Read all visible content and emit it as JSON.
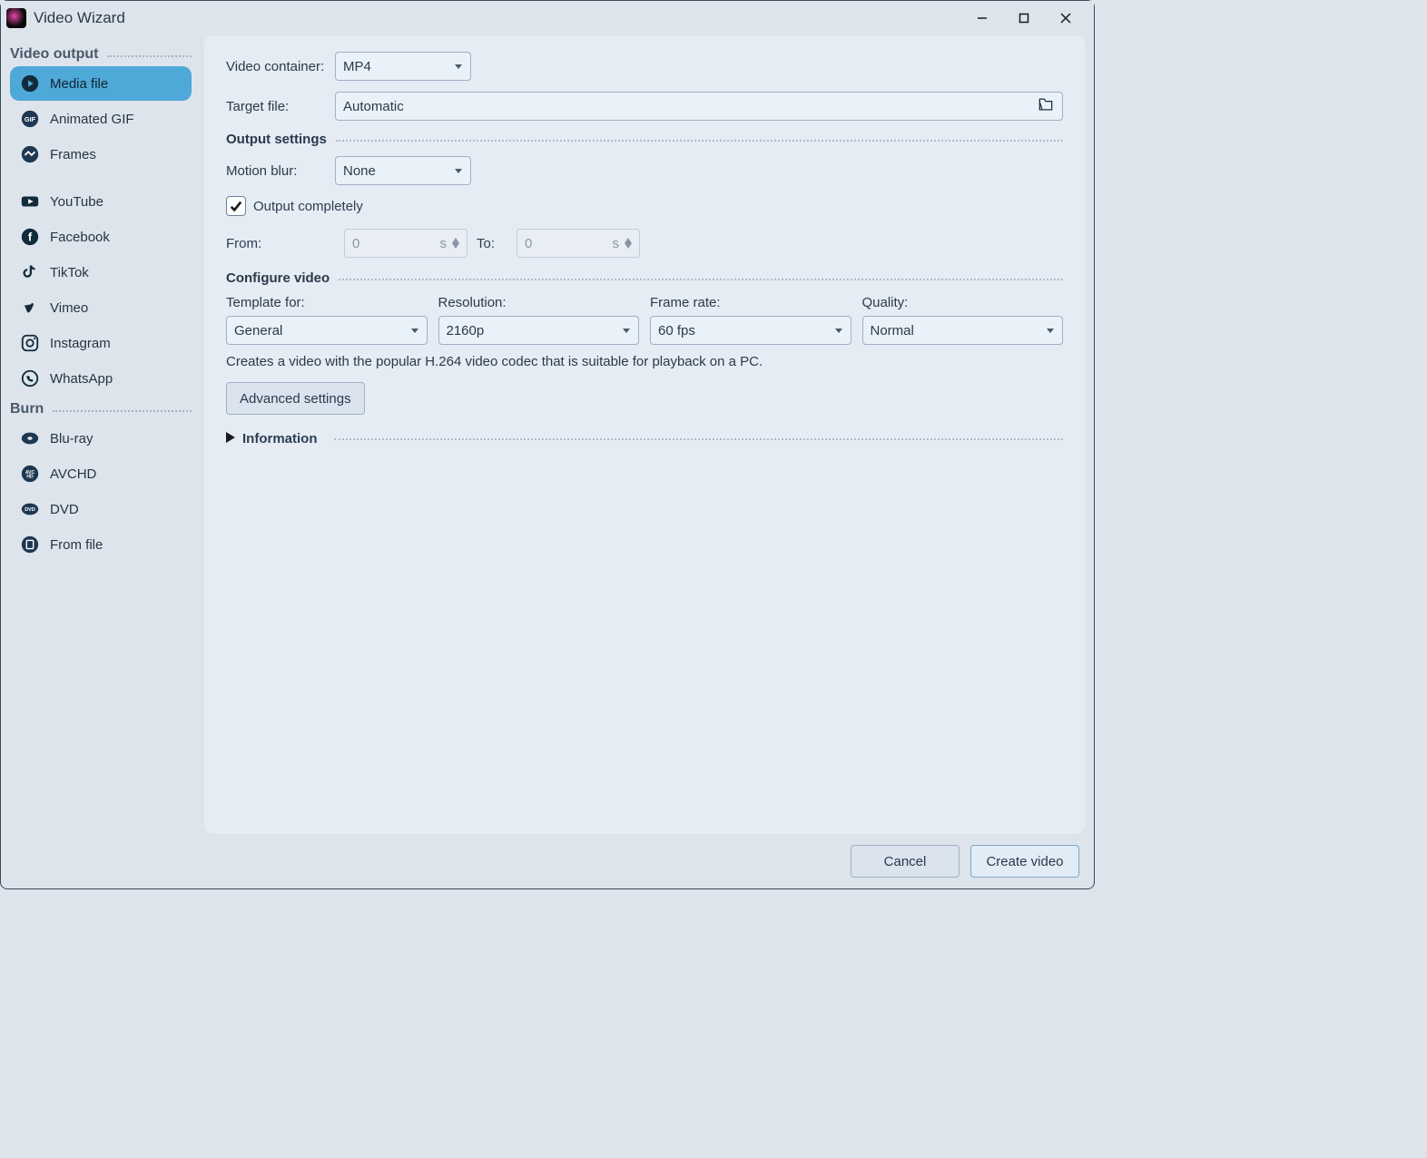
{
  "window": {
    "title": "Video Wizard",
    "titlebar_icon": "app-icon"
  },
  "sidebar": {
    "sections": [
      {
        "header": "Video output",
        "items": [
          {
            "id": "media-file",
            "label": "Media file",
            "icon": "play-circle-icon",
            "selected": true
          },
          {
            "id": "animated-gif",
            "label": "Animated GIF",
            "icon": "gif-icon"
          },
          {
            "id": "frames",
            "label": "Frames",
            "icon": "frames-icon"
          },
          {
            "id": "youtube",
            "label": "YouTube",
            "icon": "youtube-icon"
          },
          {
            "id": "facebook",
            "label": "Facebook",
            "icon": "facebook-icon"
          },
          {
            "id": "tiktok",
            "label": "TikTok",
            "icon": "tiktok-icon"
          },
          {
            "id": "vimeo",
            "label": "Vimeo",
            "icon": "vimeo-icon"
          },
          {
            "id": "instagram",
            "label": "Instagram",
            "icon": "instagram-icon"
          },
          {
            "id": "whatsapp",
            "label": "WhatsApp",
            "icon": "whatsapp-icon"
          }
        ]
      },
      {
        "header": "Burn",
        "items": [
          {
            "id": "bluray",
            "label": "Blu-ray",
            "icon": "bluray-icon"
          },
          {
            "id": "avchd",
            "label": "AVCHD",
            "icon": "avchd-icon"
          },
          {
            "id": "dvd",
            "label": "DVD",
            "icon": "dvd-icon"
          },
          {
            "id": "from-file",
            "label": "From file",
            "icon": "file-icon"
          }
        ]
      }
    ]
  },
  "form": {
    "video_container_label": "Video container:",
    "video_container_value": "MP4",
    "target_file_label": "Target file:",
    "target_file_value": "Automatic",
    "output_settings_header": "Output settings",
    "motion_blur_label": "Motion blur:",
    "motion_blur_value": "None",
    "output_completely_label": "Output completely",
    "output_completely_checked": true,
    "from_label": "From:",
    "from_value": "0",
    "from_unit": "s",
    "to_label": "To:",
    "to_value": "0",
    "to_unit": "s",
    "configure_video_header": "Configure video",
    "template_label": "Template for:",
    "template_value": "General",
    "resolution_label": "Resolution:",
    "resolution_value": "2160p",
    "framerate_label": "Frame rate:",
    "framerate_value": "60 fps",
    "quality_label": "Quality:",
    "quality_value": "Normal",
    "description": "Creates a video with the popular H.264 video codec that is suitable for playback on a PC.",
    "advanced_button": "Advanced settings",
    "information_header": "Information"
  },
  "footer": {
    "cancel": "Cancel",
    "create": "Create video"
  }
}
